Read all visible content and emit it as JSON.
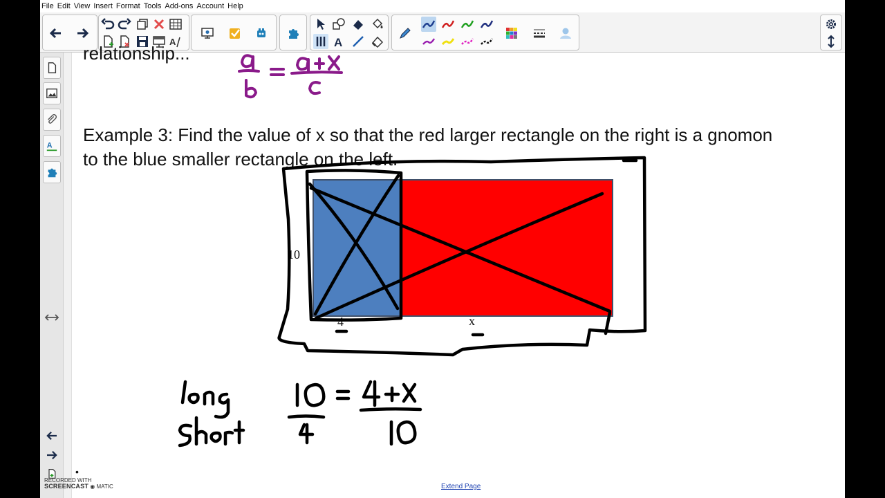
{
  "menu": [
    "File",
    "Edit",
    "View",
    "Insert",
    "Format",
    "Tools",
    "Add-ons",
    "Account",
    "Help"
  ],
  "toolbar": {
    "groups": [
      {
        "name": "navigation",
        "tools": [
          "back-icon",
          "forward-icon"
        ]
      },
      {
        "name": "page",
        "tools": [
          "undo-icon",
          "redo-icon",
          "copy-icon",
          "delete-icon",
          "table-icon",
          "new-page-icon",
          "delete-page-icon",
          "save-icon",
          "screen-shade-icon",
          "text-recognition-icon"
        ]
      },
      {
        "name": "presentation",
        "tools": [
          "screen-share-icon",
          "response-icon",
          "widget-icon"
        ]
      },
      {
        "name": "addons",
        "tools": [
          "puzzle-icon"
        ]
      },
      {
        "name": "draw",
        "tools": [
          "select-icon",
          "shapes-icon",
          "eraser-fill-icon",
          "fill-icon",
          "pen-select-icon",
          "text-icon",
          "line-icon",
          "eraser-icon"
        ]
      },
      {
        "name": "pens",
        "tools": [
          "pen-icon",
          "pen-blue",
          "pen-red",
          "pen-green",
          "pen-navy",
          "pen-purple",
          "pen-yellow",
          "pen-magenta",
          "pen-black",
          "color-palette-icon",
          "line-properties-icon",
          "avatar-icon"
        ]
      },
      {
        "name": "settings",
        "tools": [
          "gear-icon",
          "expand-icon"
        ]
      }
    ]
  },
  "colors": {
    "blue_rect": "#4d7fbf",
    "red_rect": "#ff0000",
    "ink_purple": "#8a1a8a",
    "ink_black": "#000000"
  },
  "canvas": {
    "partial_top_text": "relationship...",
    "example_line1": "Example 3: Find the value of x so that the red larger rectangle on the right is a gnomon",
    "example_line2": "to the blue smaller rectangle on the left.",
    "label_side": "10",
    "label_blue_bottom": "4",
    "label_red_bottom": "x",
    "purple_proportion": {
      "a": "a",
      "b": "b",
      "rhs_top": "a + x",
      "rhs_bottom": "c"
    },
    "handwritten_labels": {
      "long": "long",
      "short": "Short"
    },
    "handwritten_equation": {
      "lhs_top": "10",
      "lhs_bottom": "4",
      "rhs_top": "4 + x",
      "rhs_bottom": "10"
    }
  },
  "extend_page": "Extend Page",
  "watermark": {
    "line1": "RECORDED WITH",
    "line2": "SCREENCAST",
    "line3": "MATIC"
  }
}
